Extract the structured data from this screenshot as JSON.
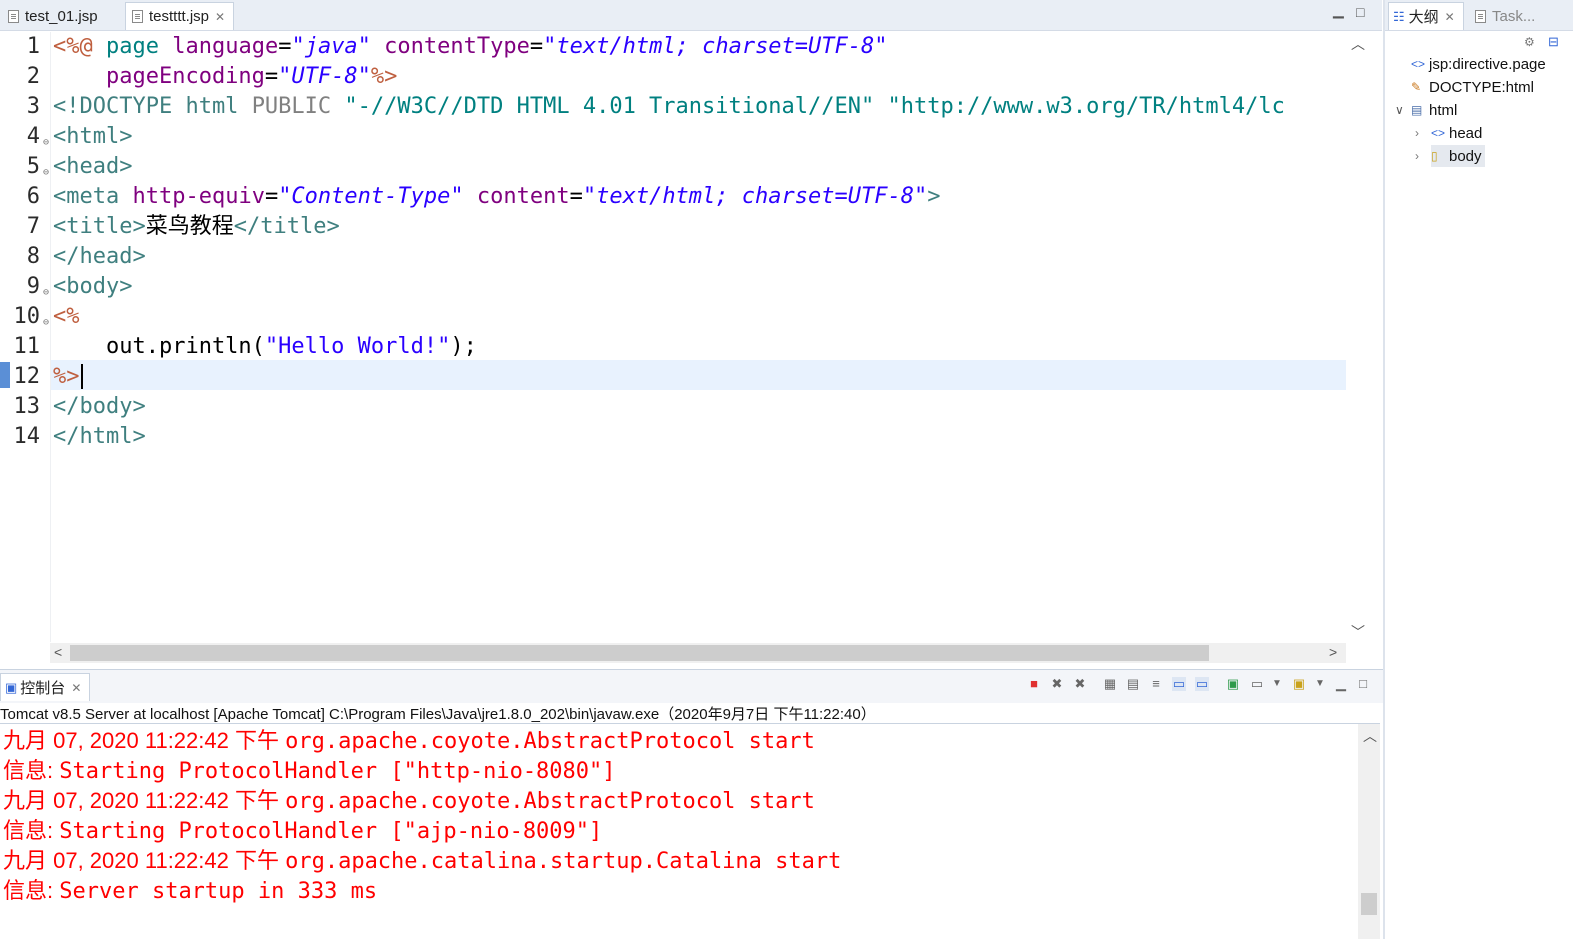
{
  "editor": {
    "tabs": [
      {
        "label": "test_01.jsp"
      },
      {
        "label": "testttt.jsp",
        "close": "✕"
      }
    ],
    "line_numbers": [
      "1",
      "2",
      "3",
      "4",
      "5",
      "6",
      "7",
      "8",
      "9",
      "10",
      "11",
      "12",
      "13",
      "14"
    ],
    "lines": {
      "l1": {
        "a": "<%@",
        "b": " page ",
        "c": "language",
        "d": "=",
        "e": "\"java\"",
        "f": " contentType",
        "g": "=",
        "h": "\"text/html; charset=UTF-8\""
      },
      "l2": {
        "a": "    pageEncoding",
        "b": "=",
        "c": "\"UTF-8\"",
        "d": "%>"
      },
      "l3": {
        "a": "<!DOCTYPE html ",
        "b": "PUBLIC",
        "c": " \"-//W3C//DTD HTML 4.01 Transitional//EN\" \"http://www.w3.org/TR/html4/lc"
      },
      "l4": "<html>",
      "l5": "<head>",
      "l6": {
        "a": "<meta ",
        "b": "http-equiv",
        "c": "=",
        "d": "\"Content-Type\"",
        "e": " content",
        "f": "=",
        "g": "\"text/html; charset=UTF-8\"",
        "h": ">"
      },
      "l7": {
        "a": "<title>",
        "b": "菜鸟教程",
        "c": "</title>"
      },
      "l8": "</head>",
      "l9": "<body>",
      "l10": "<%",
      "l11": {
        "a": "    out.println(",
        "b": "\"Hello World!\"",
        "c": ");"
      },
      "l12": "%>",
      "l13": "</body>",
      "l14": "</html>"
    }
  },
  "outline": {
    "tabs": [
      {
        "label": "大纲",
        "close": "✕"
      },
      {
        "label": "Task..."
      }
    ],
    "items": [
      {
        "label": "jsp:directive.page"
      },
      {
        "label": "DOCTYPE:html"
      },
      {
        "label": "html"
      },
      {
        "label": "head"
      },
      {
        "label": "body"
      }
    ]
  },
  "console": {
    "tab_label": "控制台",
    "close": "✕",
    "launch_label": "Tomcat v8.5 Server at localhost [Apache Tomcat] C:\\Program Files\\Java\\jre1.8.0_202\\bin\\javaw.exe（2020年9月7日 下午11:22:40）",
    "lines": [
      {
        "prefix": "九月 07, 2020 11:22:42 下午 ",
        "text": "org.apache.coyote.AbstractProtocol start"
      },
      {
        "prefix": "信息: ",
        "text": "Starting ProtocolHandler [\"http-nio-8080\"]"
      },
      {
        "prefix": "九月 07, 2020 11:22:42 下午 ",
        "text": "org.apache.coyote.AbstractProtocol start"
      },
      {
        "prefix": "信息: ",
        "text": "Starting ProtocolHandler [\"ajp-nio-8009\"]"
      },
      {
        "prefix": "九月 07, 2020 11:22:42 下午 ",
        "text": "org.apache.catalina.startup.Catalina start"
      },
      {
        "prefix": "信息: ",
        "text": "Server startup in 333 ms"
      }
    ]
  },
  "icons": {
    "minimize": "minimize-icon",
    "maximize": "maximize-icon",
    "terminate": "terminate-icon",
    "remove": "remove-launch-icon",
    "remove_all": "remove-all-icon"
  },
  "colors": {
    "tag": "#3f7f7f",
    "directive": "#bf5f3f",
    "attribute": "#7f007f",
    "value": "#2a00ff",
    "console_error": "#ff0000",
    "current_line": "#e8f2fe"
  }
}
